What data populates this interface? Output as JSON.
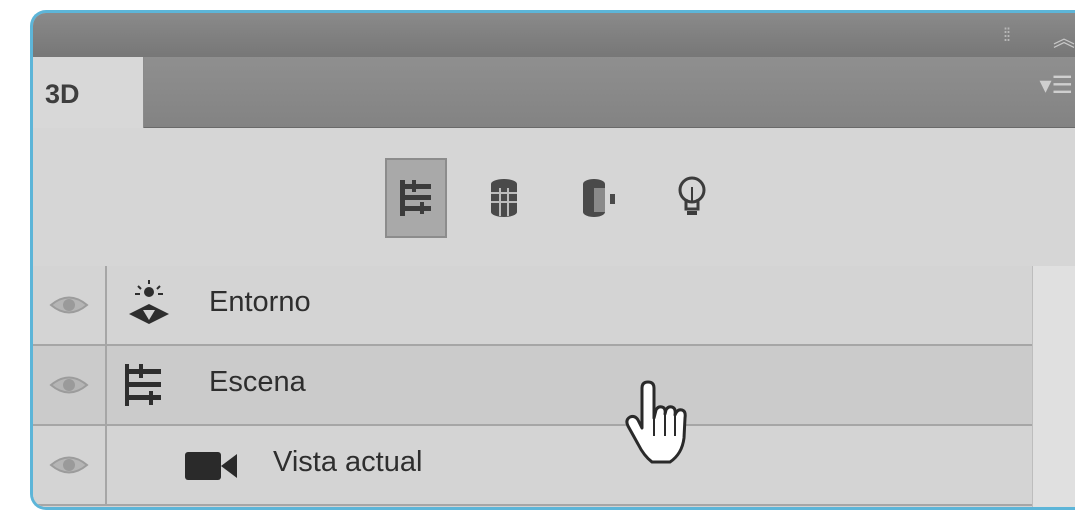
{
  "panel": {
    "tab_label": "3D",
    "filter_buttons": [
      {
        "icon": "scene-filter-icon",
        "active": true
      },
      {
        "icon": "mesh-filter-icon",
        "active": false
      },
      {
        "icon": "material-filter-icon",
        "active": false
      },
      {
        "icon": "light-filter-icon",
        "active": false
      }
    ],
    "rows": [
      {
        "label": "Entorno",
        "icon": "environment-icon",
        "visible": true
      },
      {
        "label": "Escena",
        "icon": "scene-icon",
        "visible": true
      },
      {
        "label": "Vista actual",
        "icon": "camera-icon",
        "visible": true
      }
    ]
  },
  "colors": {
    "frame_border": "#5db5d8",
    "panel_bg": "#d4d4d4",
    "titlebar": "#808080"
  }
}
